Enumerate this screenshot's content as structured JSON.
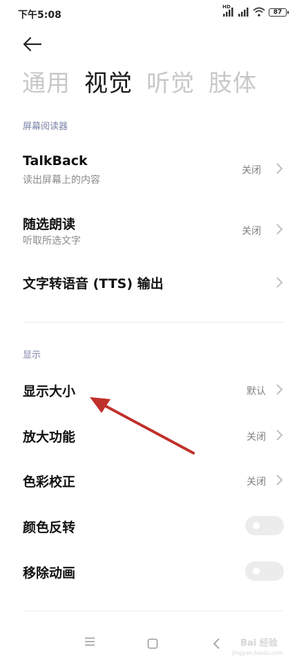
{
  "status_bar": {
    "time": "下午5:08",
    "hd": "HD",
    "battery": "87"
  },
  "tabs": [
    {
      "label": "通用",
      "active": false
    },
    {
      "label": "视觉",
      "active": true
    },
    {
      "label": "听觉",
      "active": false
    },
    {
      "label": "肢体",
      "active": false
    }
  ],
  "screen_reader": {
    "header": "屏幕阅读器",
    "items": [
      {
        "title": "TalkBack",
        "subtitle": "读出屏幕上的内容",
        "value": "关闭"
      },
      {
        "title": "随选朗读",
        "subtitle": "听取所选文字",
        "value": "关闭"
      },
      {
        "title": "文字转语音 (TTS) 输出",
        "subtitle": "",
        "value": ""
      }
    ]
  },
  "display": {
    "header": "显示",
    "items": [
      {
        "title": "显示大小",
        "value": "默认"
      },
      {
        "title": "放大功能",
        "value": "关闭"
      },
      {
        "title": "色彩校正",
        "value": "关闭"
      }
    ],
    "toggles": [
      {
        "title": "颜色反转",
        "on": false
      },
      {
        "title": "移除动画",
        "on": false
      }
    ]
  },
  "watermark": {
    "text": "Bai 经验",
    "url": "jingyan.baidu.com"
  },
  "icons": {
    "back": "back-arrow-icon",
    "chevron": "chevron-right-icon",
    "nav_menu": "menu-icon",
    "nav_home": "home-square-icon",
    "nav_back": "nav-back-icon"
  },
  "colors": {
    "section_header": "#7a83a8",
    "annotation_arrow": "#c0302a"
  }
}
